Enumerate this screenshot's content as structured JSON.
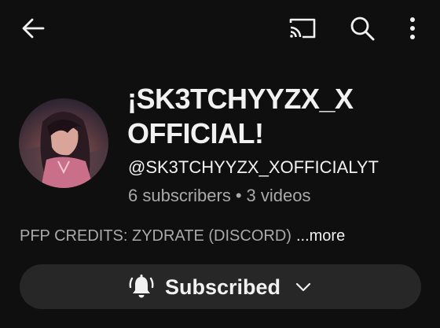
{
  "topbar": {
    "icons": [
      "back-arrow-icon",
      "cast-icon",
      "search-icon",
      "more-vertical-icon"
    ]
  },
  "channel": {
    "title": "¡SK3TCHYYZX_X OFFICIAL!",
    "handle": "@SK3TCHYYZX_XOFFICIALYT",
    "subscribers": "6 subscribers",
    "separator": "•",
    "videos": "3 videos",
    "description": "PFP CREDITS: ZYDRATE (DISCORD)",
    "more_label": "...more"
  },
  "subscribe": {
    "label": "Subscribed",
    "icons": [
      "bell-icon",
      "chevron-down-icon"
    ]
  },
  "colors": {
    "background": "#0f0f0f",
    "text_primary": "#f1f1f1",
    "text_secondary": "#aaaaaa",
    "button_bg": "#272727"
  }
}
